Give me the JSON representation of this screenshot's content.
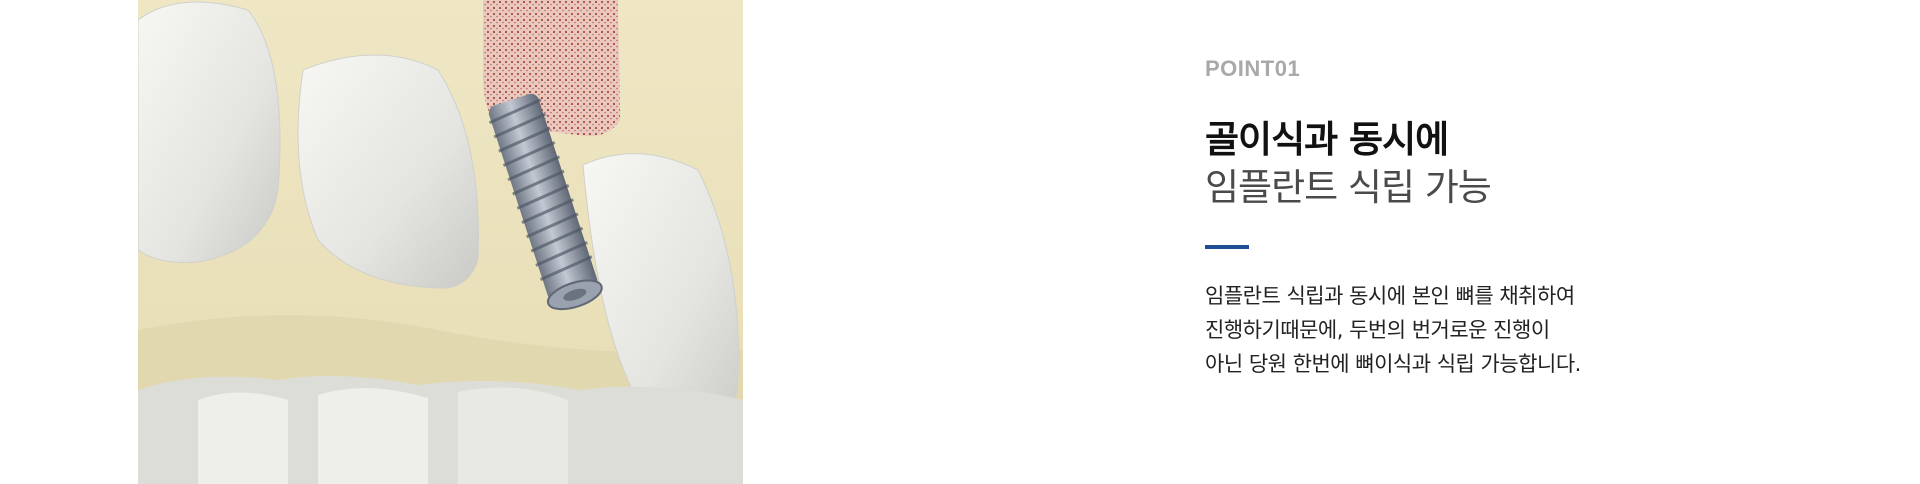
{
  "illustration": {
    "icon": "dental-implant-illustration"
  },
  "content": {
    "point_label": "POINT01",
    "headline_bold": "골이식과 동시에",
    "headline_light": "임플란트 식립 가능",
    "accent_color": "#1f4e96",
    "description_lines": [
      "임플란트 식립과 동시에 본인 뼈를 채취하여",
      "진행하기때문에, 두번의 번거로운 진행이",
      "아닌 당원 한번에 뼈이식과 식립 가능합니다."
    ]
  }
}
